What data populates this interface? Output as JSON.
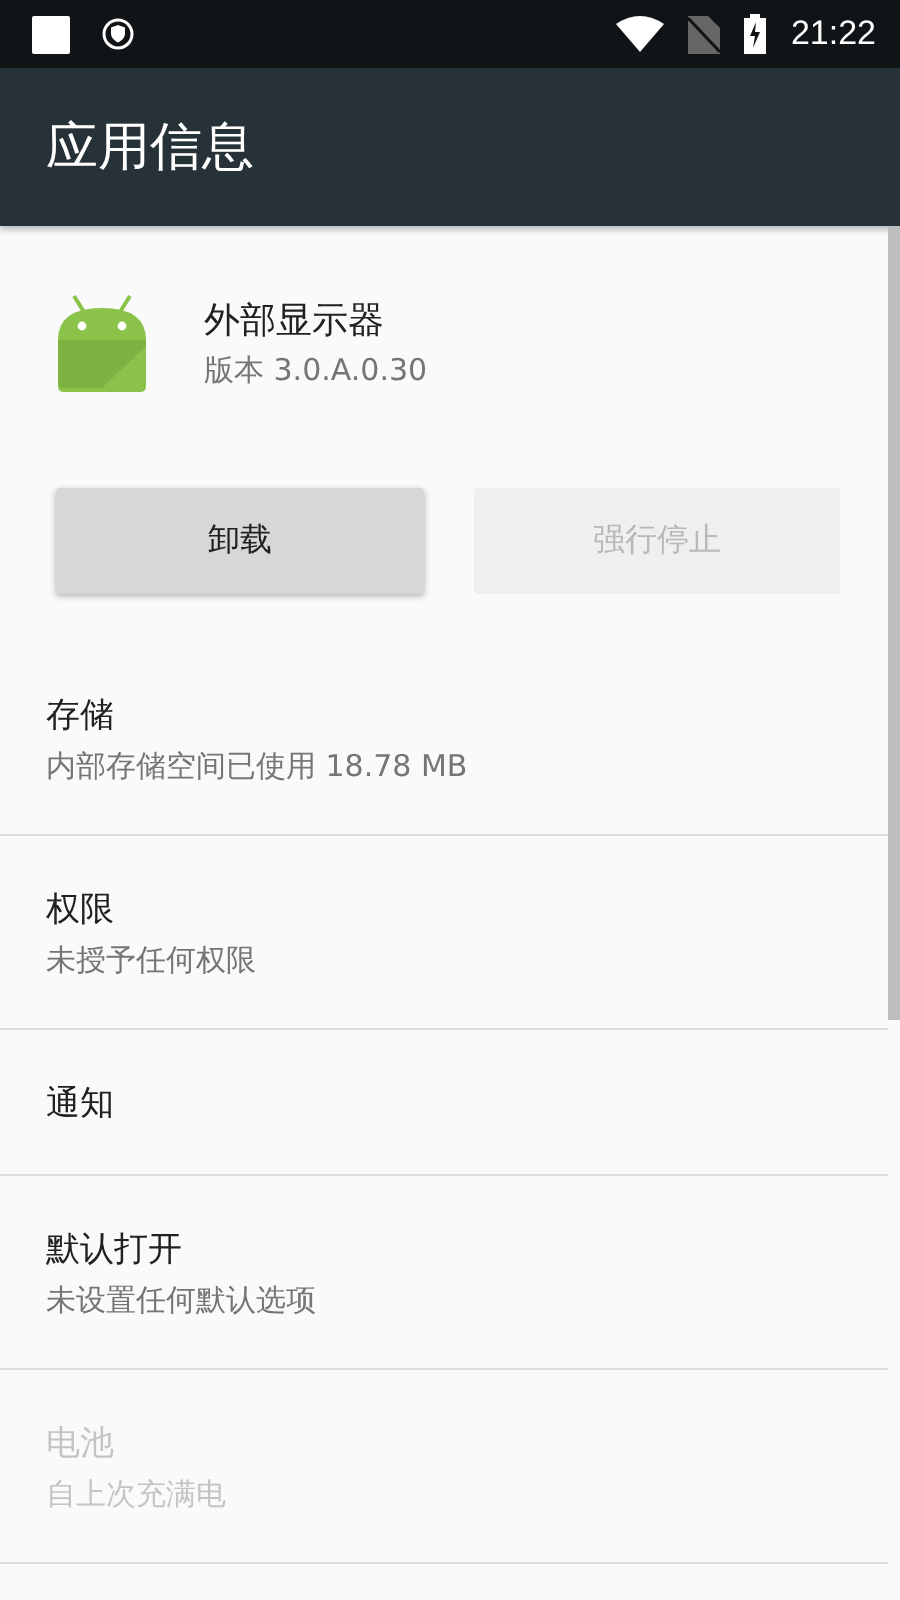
{
  "status_bar": {
    "time": "21:22"
  },
  "app_bar": {
    "title": "应用信息"
  },
  "app": {
    "name": "外部显示器",
    "version": "版本 3.0.A.0.30"
  },
  "buttons": [
    {
      "label": "卸载",
      "disabled": false
    },
    {
      "label": "强行停止",
      "disabled": true
    }
  ],
  "items": [
    {
      "title": "存储",
      "subtitle": "内部存储空间已使用 18.78 MB",
      "disabled": false
    },
    {
      "title": "权限",
      "subtitle": "未授予任何权限",
      "disabled": false
    },
    {
      "title": "通知",
      "disabled": false
    },
    {
      "title": "默认打开",
      "subtitle": "未设置任何默认选项",
      "disabled": false
    },
    {
      "title": "电池",
      "subtitle": "自上次充满电",
      "disabled": true
    }
  ]
}
